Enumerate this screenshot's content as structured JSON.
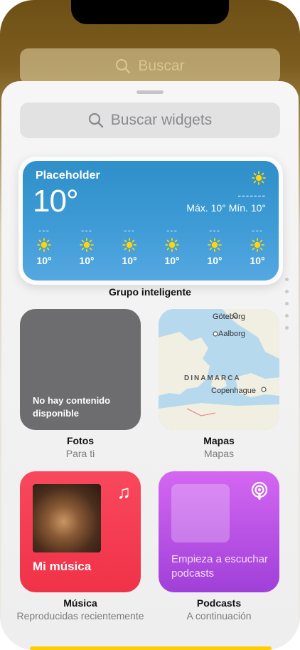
{
  "top_search": {
    "label": "Buscar"
  },
  "widget_search": {
    "placeholder": "Buscar widgets"
  },
  "smart_stack": {
    "caption": "Grupo inteligente",
    "weather": {
      "location": "Placeholder",
      "temperature": "10°",
      "condition_placeholder": "-------",
      "hi_lo": "Máx. 10° Mín. 10°",
      "hours": [
        {
          "label": "---",
          "icon": "sun-icon",
          "temp": "10°"
        },
        {
          "label": "---",
          "icon": "sun-icon",
          "temp": "10°"
        },
        {
          "label": "---",
          "icon": "sun-icon",
          "temp": "10°"
        },
        {
          "label": "---",
          "icon": "sun-icon",
          "temp": "10°"
        },
        {
          "label": "---",
          "icon": "sun-icon",
          "temp": "10°"
        },
        {
          "label": "---",
          "icon": "sun-icon",
          "temp": "10°"
        }
      ]
    }
  },
  "widgets": {
    "photos": {
      "message": "No hay contenido disponible",
      "title": "Fotos",
      "subtitle": "Para ti"
    },
    "maps": {
      "title": "Mapas",
      "subtitle": "Mapas",
      "places": [
        "Göteborg",
        "Aalborg",
        "DINAMARCA",
        "Copenhague"
      ]
    },
    "music": {
      "label": "Mi música",
      "title": "Música",
      "subtitle": "Reproducidas recientemente"
    },
    "podcasts": {
      "label": "Empieza a escuchar podcasts",
      "title": "Podcasts",
      "subtitle": "A continuación"
    }
  },
  "colors": {
    "weather": "#3e9bd6",
    "music": "#f5394f",
    "podcasts": "#b84ee3",
    "photos": "#6d6d6f"
  }
}
